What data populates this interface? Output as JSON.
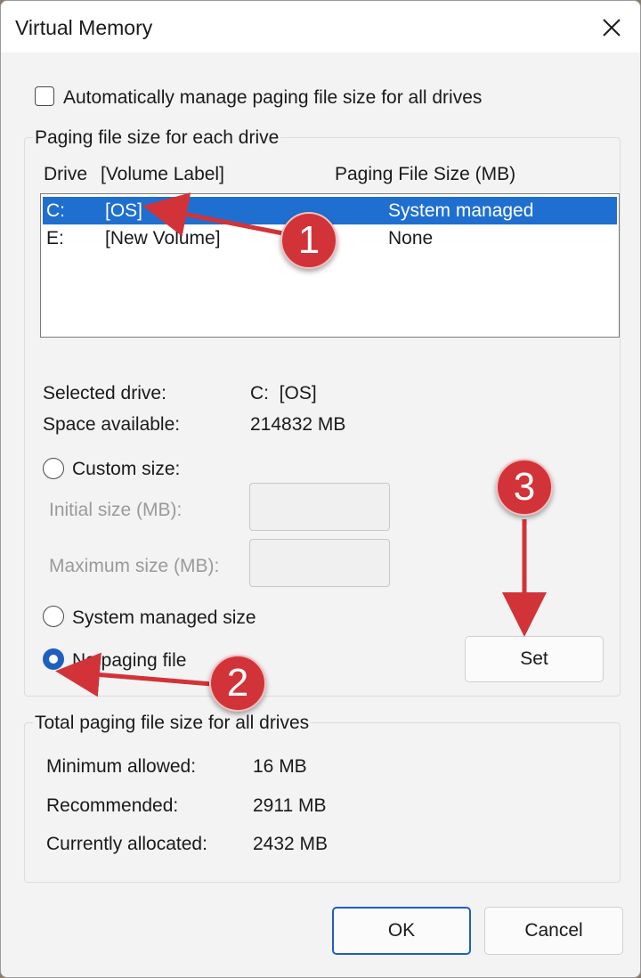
{
  "window": {
    "title": "Virtual Memory",
    "close_glyph": "✕"
  },
  "auto_manage": {
    "label": "Automatically manage paging file size for all drives",
    "checked": false
  },
  "paging_group": {
    "title": "Paging file size for each drive",
    "headers": {
      "drive": "Drive",
      "volume_label": "[Volume Label]",
      "size": "Paging File Size (MB)"
    },
    "rows": [
      {
        "drive": "C:",
        "label": "[OS]",
        "size": "System managed",
        "selected": true
      },
      {
        "drive": "E:",
        "label": "[New Volume]",
        "size": "None",
        "selected": false
      }
    ],
    "selected_drive_label": "Selected drive:",
    "selected_drive_value": "C:  [OS]",
    "space_available_label": "Space available:",
    "space_available_value": "214832 MB",
    "custom_size_label": "Custom size:",
    "initial_size_label": "Initial size (MB):",
    "initial_size_value": "",
    "maximum_size_label": "Maximum size (MB):",
    "maximum_size_value": "",
    "system_managed_label": "System managed size",
    "no_paging_label": "No paging file",
    "selected_option": "no_paging",
    "set_button": "Set"
  },
  "total_group": {
    "title": "Total paging file size for all drives",
    "minimum_label": "Minimum allowed:",
    "minimum_value": "16 MB",
    "recommended_label": "Recommended:",
    "recommended_value": "2911 MB",
    "allocated_label": "Currently allocated:",
    "allocated_value": "2432 MB"
  },
  "footer": {
    "ok": "OK",
    "cancel": "Cancel"
  },
  "annotations": {
    "marker_1": "1",
    "marker_2": "2",
    "marker_3": "3",
    "color": "#d23338"
  },
  "colors": {
    "selection": "#1f6fd1",
    "accent": "#1e5fbf"
  }
}
